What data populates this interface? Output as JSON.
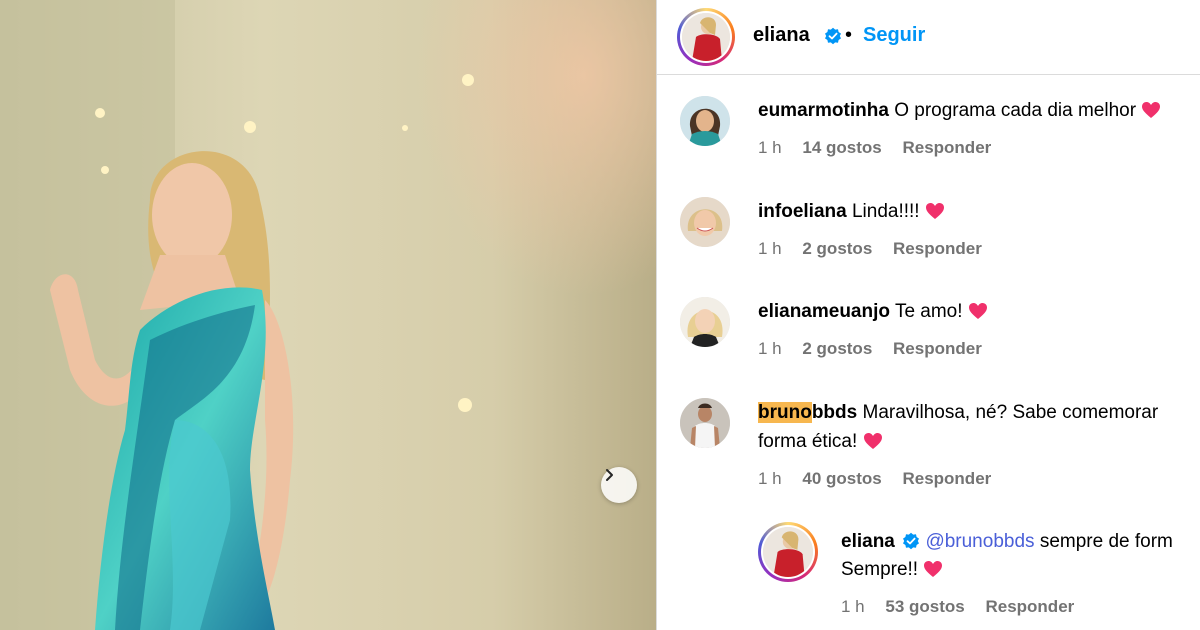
{
  "post": {
    "author": "eliana",
    "separator": "•",
    "follow_label": "Seguir"
  },
  "icons": {
    "verified": "verified-badge-icon",
    "heart": "red-heart-emoji",
    "next": "chevron-right-icon"
  },
  "colors": {
    "follow": "#0095f6",
    "mention": "#4a5fd8",
    "highlight": "#f7b74f",
    "heart": "#f0306b",
    "verified": "#0095f6"
  },
  "comments": [
    {
      "user": "eumarmotinha",
      "text": "O programa cada dia melhor",
      "time": "1 h",
      "likes": "14 gostos",
      "reply": "Responder"
    },
    {
      "user": "infoeliana",
      "text": "Linda!!!!",
      "time": "1 h",
      "likes": "2 gostos",
      "reply": "Responder"
    },
    {
      "user": "elianameuanjo",
      "text": "Te amo!",
      "time": "1 h",
      "likes": "2 gostos",
      "reply": "Responder"
    },
    {
      "user_highlight": "bruno",
      "user_rest": "bbds",
      "text_line1": "Maravilhosa, né? Sabe comemorar",
      "text_line2": "forma ética!",
      "time": "1 h",
      "likes": "40 gostos",
      "reply": "Responder"
    }
  ],
  "reply": {
    "user": "eliana",
    "mention": "@brunobbds",
    "text_line1": "sempre de form",
    "text_line2": "Sempre!!",
    "time": "1 h",
    "likes": "53 gostos",
    "reply": "Responder"
  }
}
